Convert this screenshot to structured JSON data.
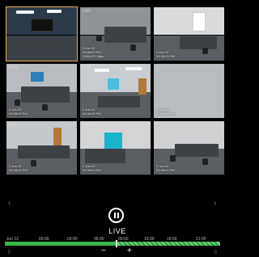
{
  "cameras": [
    {
      "name": "",
      "info": "",
      "selected": true
    },
    {
      "name": "CH2",
      "info": "2 Jun 22\n09:38:03 PM\n1280x720 8fps"
    },
    {
      "name": "CH3",
      "info": "2 Jun 22\n09:38:03 PM"
    },
    {
      "name": "CH4",
      "info": "2 Jun 22\n09:38:03 PM"
    },
    {
      "name": "CH5",
      "info": "2 Jun 22\n09:38:03 PM"
    },
    {
      "name": "",
      "info": "2 Jun 22\n09:38:03 PM"
    },
    {
      "name": "CH7",
      "info": "2 Jun 22\n09:38:03 PM"
    },
    {
      "name": "CH8",
      "info": "2 Jun 22\n09:38:03 PM"
    },
    {
      "name": "",
      "info": "2 Jun 22\n09:38:03 PM"
    }
  ],
  "playback": {
    "live_label": "LIVE",
    "timeline_labels": [
      "Jun 12",
      "00:00",
      "03:00",
      "06:00",
      "09:00",
      "15:00",
      "18:00",
      "21:00"
    ],
    "zoom_out": "−",
    "zoom_in": "+"
  },
  "nav": {
    "prev": "‹",
    "next": "›"
  },
  "grip": "⠿",
  "colors": {
    "selected_border": "#e8b04a",
    "timeline": "#39b54a"
  }
}
